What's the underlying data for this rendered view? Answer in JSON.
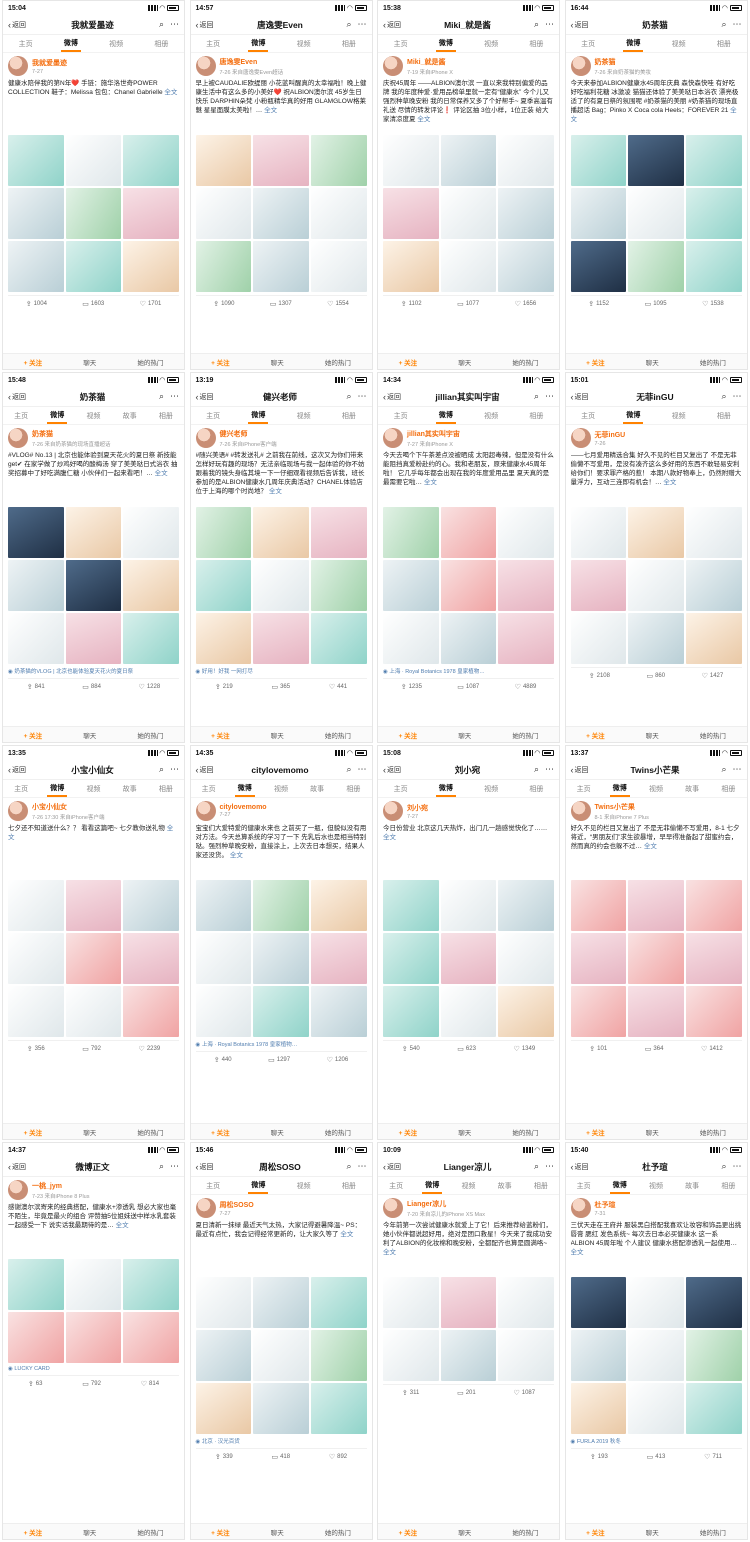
{
  "common": {
    "back_label": "返回",
    "follow_label": "+ 关注",
    "chat_label": "聊天",
    "hot_label": "她的热门",
    "more_label": "全文"
  },
  "panels": [
    {
      "time": "15:04",
      "title": "我就爱墨迹",
      "tabs": [
        "主页",
        "微博",
        "视频",
        "相册"
      ],
      "active": 1,
      "user": "我就爱墨迹",
      "meta": "7-27",
      "text": "健康水陪伴我的第N年❤️ 手链：施华洛世奇POWER COLLECTION 鞋子：Melissa 包包：Chanel Gabrielle",
      "loc": "",
      "stats": [
        "1004",
        "1603",
        "1701"
      ],
      "colors": [
        "c1",
        "c9",
        "c1",
        "c3",
        "c5",
        "c2",
        "c3",
        "c1",
        "c4"
      ]
    },
    {
      "time": "14:57",
      "title": "唐逸雯Even",
      "tabs": [
        "主页",
        "微博",
        "视频",
        "相册"
      ],
      "active": 1,
      "user": "唐逸雯Even",
      "meta": "7-26 来自唐逸雯Even超话",
      "text": "早上被CAUDALIE欧缇丽 小花蓝叫醒真的太幸福啦！晚上健康生活中有这么多的小美好❤️ 祝ALBION澳尔滨 45岁生日快乐 DARPHIN朵梵 小粉瓶精华真的好用 GLAMGLOW格莱魅 星星面膜太美啦！…",
      "loc": "",
      "stats": [
        "1090",
        "1307",
        "1554"
      ],
      "colors": [
        "c4",
        "c2",
        "c5",
        "c9",
        "c3",
        "c9",
        "c5",
        "c3",
        "c9"
      ]
    },
    {
      "time": "15:38",
      "title": "Miki_就是酱",
      "tabs": [
        "主页",
        "微博",
        "视频",
        "相册"
      ],
      "active": 1,
      "user": "Miki_就是酱",
      "meta": "7-19 来自iPhone X",
      "text": "庆祝45周年 ——ALBION澳尔滨 一直以来我特别偏爱的品牌 我的年度种爱·爱用品榜单里就一定有“健康水” 今个儿又强烈种草晚安粉 我的日常保养又多了个好帮手~ 夏季高温有礼送 尽情的转发评论❗ 评论区抽 3位小样，1位正装 给大家清凉度夏",
      "loc": "",
      "stats": [
        "1102",
        "1077",
        "1656"
      ],
      "colors": [
        "c9",
        "c3",
        "c9",
        "c2",
        "c9",
        "c3",
        "c4",
        "c9",
        "c3"
      ]
    },
    {
      "time": "16:44",
      "title": "奶茶猫",
      "tabs": [
        "主页",
        "微博",
        "视频",
        "相册"
      ],
      "active": 1,
      "user": "奶茶猫",
      "meta": "7-26 来自奶茶猫的美妆",
      "text": "今天来参加ALBION健康水45周年庆典 森快森快哇 有好吃好吃福利花糖 冰激凌 猫猫还体验了美美哒日本浴衣 漂亮极适了的有夏日祭的氛围呢 #奶茶猫的美丽 #奶茶猫的现场直播超话 Bag：Pinko X Coca cola Heels：FOREVER 21",
      "loc": "",
      "stats": [
        "1152",
        "1095",
        "1538"
      ],
      "colors": [
        "c1",
        "c7",
        "c1",
        "c3",
        "c9",
        "c1",
        "c7",
        "c5",
        "c1"
      ]
    },
    {
      "time": "15:48",
      "title": "奶茶猫",
      "tabs": [
        "主页",
        "微博",
        "视频",
        "故事",
        "相册"
      ],
      "active": 1,
      "user": "奶茶猫",
      "meta": "7-26 来自奶茶猫的现场直播超话",
      "text": "#VLOG# No.13 | 北京也能体验到夏天花火的夏日祭 新技能get✔ 在家学做了炒鸡好喝的酸梅汤 穿了美美哒日式浴衣 抽奖招募中了好吃满腹仁糖 小伙伴们一起来看吧！…",
      "loc": "奶茶猫的VLOG | 北京也能体验夏天花火的夏日祭",
      "stats": [
        "841",
        "884",
        "1228"
      ],
      "colors": [
        "c7",
        "c4",
        "c9",
        "c3",
        "c7",
        "c4",
        "c9",
        "c2",
        "c1"
      ]
    },
    {
      "time": "13:19",
      "title": "健兴老师",
      "tabs": [
        "主页",
        "微博",
        "视频",
        "相册"
      ],
      "active": 1,
      "user": "健兴老师",
      "meta": "7-26 来自iPhone客户端",
      "text": "#随兴美语# #转发送礼# 之前我在前线，这次又为你们带来怎样好玩有趣的现场？无法亲临现场与我一起体验的你不妨跟着我的镜头身临其境一下一仔细观看视频后告诉我，班长参加的是ALBION健康水几周年庆典活动？CHANEL体验店位于上海的哪个时尚地？",
      "loc": "好用！好我 一网打尽",
      "stats": [
        "219",
        "365",
        "441"
      ],
      "colors": [
        "c5",
        "c4",
        "c2",
        "c1",
        "c9",
        "c5",
        "c4",
        "c2",
        "c1"
      ]
    },
    {
      "time": "14:34",
      "title": "jillian其实叫宇宙",
      "tabs": [
        "主页",
        "微博",
        "视频",
        "相册"
      ],
      "active": 1,
      "user": "jillian其实叫宇宙",
      "meta": "7-27 来自iPhone X",
      "text": "今天去喝个下午茶差点没被晒成 太阳超毒辣，但是没有什么能阻挡真爱粉赴约的心。我和老朋友，原来健康水45周年啦！ 它几乎每年都会出现在我的年度爱用品里 夏天真的是最需要它啦…",
      "loc": "上海 · Royal Botanics 1978 皇家植物…",
      "stats": [
        "1235",
        "1087",
        "4889"
      ],
      "colors": [
        "c5",
        "c8",
        "c9",
        "c3",
        "c8",
        "c2",
        "c9",
        "c3",
        "c2"
      ]
    },
    {
      "time": "15:01",
      "title": "无菲inGU",
      "tabs": [
        "主页",
        "微博",
        "视频",
        "相册"
      ],
      "active": 1,
      "user": "无菲inGU",
      "meta": "7-26",
      "text": "——七月爱用精选合集 好久不见的栏目又复出了 不是无菲偷懒不写爱用，是没有凑齐这么多好用的东西不敢轻易安利给你们！要求罪产格的惹！ 本期八款好物奉上，仍然附赠大量浮力，互动三连即有机会！…",
      "loc": "",
      "stats": [
        "2108",
        "860",
        "1427"
      ],
      "colors": [
        "c9",
        "c4",
        "c9",
        "c2",
        "c9",
        "c3",
        "c9",
        "c3",
        "c4"
      ]
    },
    {
      "time": "13:35",
      "title": "小宝小仙女",
      "tabs": [
        "主页",
        "微博",
        "视频",
        "故事",
        "相册"
      ],
      "active": 1,
      "user": "小宝小仙女",
      "meta": "7-26 17:30 来自iPhone客户端",
      "text": "七夕还不知道送什么？？ 看看这篇吧~ 七夕教你送礼物",
      "loc": "",
      "stats": [
        "356",
        "792",
        "2239"
      ],
      "colors": [
        "c9",
        "c2",
        "c3",
        "c9",
        "c8",
        "c2",
        "c9",
        "c9",
        "c8"
      ]
    },
    {
      "time": "14:35",
      "title": "citylovemomo",
      "tabs": [
        "主页",
        "微博",
        "视频",
        "故事",
        "相册"
      ],
      "active": 1,
      "user": "citylovemomo",
      "meta": "7-27",
      "text": "宝宝们大爱特爱的健康水来也 之前买了一瓶，但貌似没有用对方法。今天总算系统的学习了一下 先乳后水也是相当特别哒。强烈种草晚安粉，直接涂上，上次去日本想买，结果人家还没货。",
      "loc": "上海 · Royal Botanics 1978 皇家植物…",
      "stats": [
        "440",
        "1297",
        "1206"
      ],
      "colors": [
        "c3",
        "c5",
        "c4",
        "c9",
        "c3",
        "c2",
        "c9",
        "c1",
        "c3"
      ]
    },
    {
      "time": "15:08",
      "title": "刘小宛",
      "tabs": [
        "主页",
        "微博",
        "视频",
        "相册"
      ],
      "active": 1,
      "user": "刘小宛",
      "meta": "7-27",
      "text": "今日份营业 北京这几天热炸，出门几一趟感觉快化了……",
      "loc": "",
      "stats": [
        "540",
        "623",
        "1349"
      ],
      "colors": [
        "c1",
        "c9",
        "c3",
        "c1",
        "c2",
        "c9",
        "c1",
        "c9",
        "c4"
      ]
    },
    {
      "time": "13:37",
      "title": "Twins小芒果",
      "tabs": [
        "主页",
        "微博",
        "视频",
        "故事",
        "相册"
      ],
      "active": 1,
      "user": "Twins小芒果",
      "meta": "8-1 来自iPhone 7 Plus",
      "text": "好久不见的栏目又复出了 不是无菲偷懒不写爱用，8-1 七夕将近，“男朋友们”求生欲暴增，早早得准备起了甜蜜约会，然而真的约会也躲不过…",
      "loc": "",
      "stats": [
        "101",
        "364",
        "1412"
      ],
      "colors": [
        "c8",
        "c2",
        "c8",
        "c2",
        "c8",
        "c2",
        "c8",
        "c2",
        "c8"
      ]
    },
    {
      "time": "14:37",
      "title": "微博正文",
      "tabs": [],
      "active": -1,
      "user": "一桃_jym",
      "meta": "7-23 来自iPhone 8 Plus",
      "text": "感谢澳尔滨寄来的经典搭配，健康水+渗透乳 想必大家也毫不陌生，毕竟是最火的组合 评赞抽5位姐妹送中样水乳套装一起感受一下 说实话我最期待的是…",
      "loc": "LUCKY CARD",
      "stats": [
        "63",
        "792",
        "814"
      ],
      "colors": [
        "c1",
        "c9",
        "c1",
        "c8",
        "c8",
        "c8"
      ]
    },
    {
      "time": "15:46",
      "title": "周松SOSO",
      "tabs": [
        "主页",
        "微博",
        "视频",
        "相册"
      ],
      "active": 1,
      "user": "周松SOSO",
      "meta": "7-27",
      "text": "夏日清新一抹绿 最近天气太热，大家记得避暑降温~ PS：最近有点忙，我会记得经常更新的，让大家久等了",
      "loc": "北京 · 汉光百货",
      "stats": [
        "339",
        "418",
        "892"
      ],
      "colors": [
        "c9",
        "c3",
        "c1",
        "c3",
        "c9",
        "c5",
        "c4",
        "c3",
        "c1"
      ]
    },
    {
      "time": "10:09",
      "title": "Lianger凉儿",
      "tabs": [
        "主页",
        "微博",
        "视频",
        "故事",
        "相册"
      ],
      "active": 1,
      "user": "Lianger凉儿",
      "meta": "7-20 来自凉儿的iPhone XS Max",
      "text": "今年前第一次尝试健康水就爱上了它！后来推荐给蓝粉们，她小伙伴都说超好用，绝对是团口救星！今天来了我成功安利了ALBION的化妆棉和晚安粉，全都配齐也算是圆满咯~",
      "loc": "",
      "stats": [
        "311",
        "201",
        "1087"
      ],
      "colors": [
        "c9",
        "c2",
        "c9",
        "c9",
        "c3",
        "c9"
      ]
    },
    {
      "time": "15:40",
      "title": "杜予瑄",
      "tabs": [
        "主页",
        "微博",
        "视频",
        "故事",
        "相册"
      ],
      "active": 1,
      "user": "杜予瑄",
      "meta": "7-31",
      "text": "三伏天走在王府井 服装黑白搭配我喜欢让妆容和饰品更出挑 唇膏 腮红 发色系统~ 每次去日本必买健康水 这一系 ALBION 45周年啦 个人建议 健康水搭配渗透乳一起使用…",
      "loc": "FURLA 2019 秋冬",
      "stats": [
        "193",
        "413",
        "711"
      ],
      "colors": [
        "c7",
        "c9",
        "c7",
        "c3",
        "c9",
        "c5",
        "c4",
        "c9",
        "c1"
      ]
    }
  ]
}
